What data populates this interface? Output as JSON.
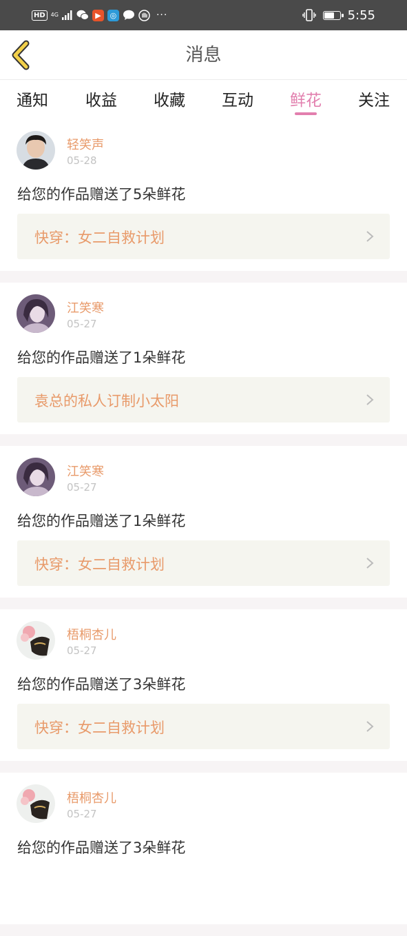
{
  "status_bar": {
    "hd": "HD",
    "network": "4G",
    "time": "5:55",
    "battery_level": 0.6,
    "more": "···"
  },
  "header": {
    "title": "消息"
  },
  "tabs": [
    {
      "label": "通知",
      "active": false
    },
    {
      "label": "收益",
      "active": false
    },
    {
      "label": "收藏",
      "active": false
    },
    {
      "label": "互动",
      "active": false
    },
    {
      "label": "鲜花",
      "active": true
    },
    {
      "label": "关注",
      "active": false
    }
  ],
  "messages": [
    {
      "user": "轻笑声",
      "date": "05-28",
      "text": "给您的作品赠送了5朵鲜花",
      "work": "快穿：女二自救计划"
    },
    {
      "user": "江笑寒",
      "date": "05-27",
      "text": "给您的作品赠送了1朵鲜花",
      "work": "袁总的私人订制小太阳"
    },
    {
      "user": "江笑寒",
      "date": "05-27",
      "text": "给您的作品赠送了1朵鲜花",
      "work": "快穿：女二自救计划"
    },
    {
      "user": "梧桐杏儿",
      "date": "05-27",
      "text": "给您的作品赠送了3朵鲜花",
      "work": "快穿：女二自救计划"
    },
    {
      "user": "梧桐杏儿",
      "date": "05-27",
      "text": "给您的作品赠送了3朵鲜花",
      "work": ""
    }
  ],
  "colors": {
    "accent": "#e27fae",
    "username": "#e89a6a",
    "back_icon": "#f2d04a"
  }
}
